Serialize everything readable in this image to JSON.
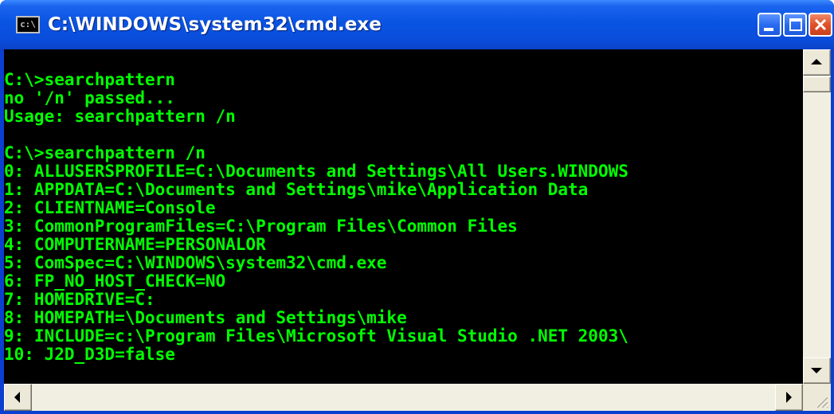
{
  "window": {
    "title": "C:\\WINDOWS\\system32\\cmd.exe",
    "icon_text": "c:\\",
    "icon_name": "console-icon",
    "controls": [
      "minimize-icon",
      "maximize-icon",
      "close-icon"
    ]
  },
  "console": {
    "text_color": "#00ff00",
    "background": "#000000",
    "lines": [
      "C:\\>searchpattern",
      "no '/n' passed...",
      "Usage: searchpattern /n",
      "",
      "C:\\>searchpattern /n",
      "0: ALLUSERSPROFILE=C:\\Documents and Settings\\All Users.WINDOWS",
      "1: APPDATA=C:\\Documents and Settings\\mike\\Application Data",
      "2: CLIENTNAME=Console",
      "3: CommonProgramFiles=C:\\Program Files\\Common Files",
      "4: COMPUTERNAME=PERSONALOR",
      "5: ComSpec=C:\\WINDOWS\\system32\\cmd.exe",
      "6: FP_NO_HOST_CHECK=NO",
      "7: HOMEDRIVE=C:",
      "8: HOMEPATH=\\Documents and Settings\\mike",
      "9: INCLUDE=c:\\Program Files\\Microsoft Visual Studio .NET 2003\\",
      "10: J2D_D3D=false"
    ]
  },
  "scrollbars": {
    "vertical": {
      "position": 0
    },
    "horizontal": {
      "position": 0
    }
  }
}
